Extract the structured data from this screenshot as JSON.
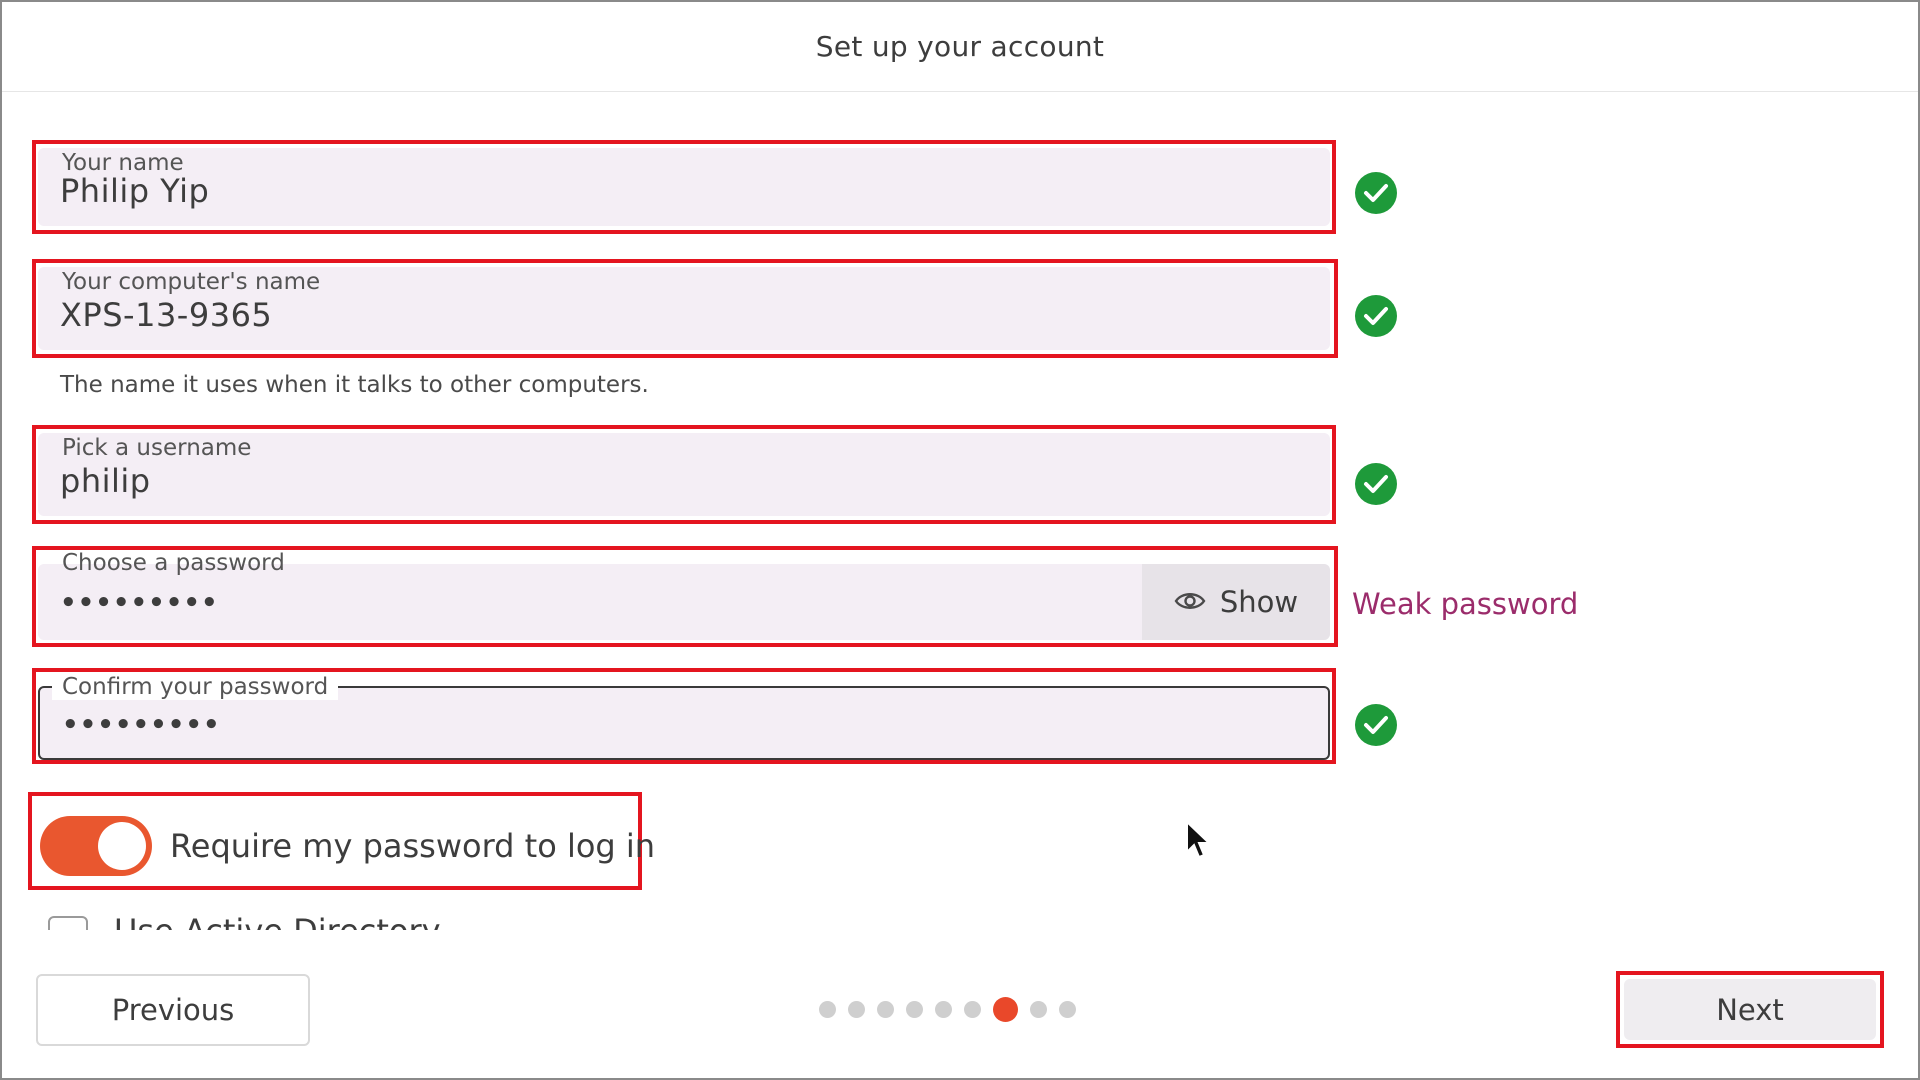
{
  "header": {
    "title": "Set up your account"
  },
  "fields": {
    "name": {
      "label": "Your name",
      "value": "Philip Yip",
      "valid": true
    },
    "computer": {
      "label": "Your computer's name",
      "value": "XPS-13-9365",
      "valid": true,
      "helper": "The name it uses when it talks to other computers."
    },
    "username": {
      "label": "Pick a username",
      "value": "philip",
      "valid": true
    },
    "password": {
      "label": "Choose a password",
      "value": "•••••••••",
      "show_label": "Show",
      "strength": "Weak password"
    },
    "confirm": {
      "label": "Confirm your password",
      "value": "•••••••••",
      "valid": true
    }
  },
  "require_password": {
    "label": "Require my password to log in",
    "checked": true
  },
  "active_directory": {
    "label": "Use Active Directory",
    "checked": false
  },
  "nav": {
    "previous_label": "Previous",
    "next_label": "Next",
    "progress": {
      "total": 9,
      "current": 7
    }
  },
  "colors": {
    "accent": "#e9482a",
    "valid": "#1e9a3a",
    "weak": "#9b2c6b",
    "highlight": "#e4151f"
  }
}
